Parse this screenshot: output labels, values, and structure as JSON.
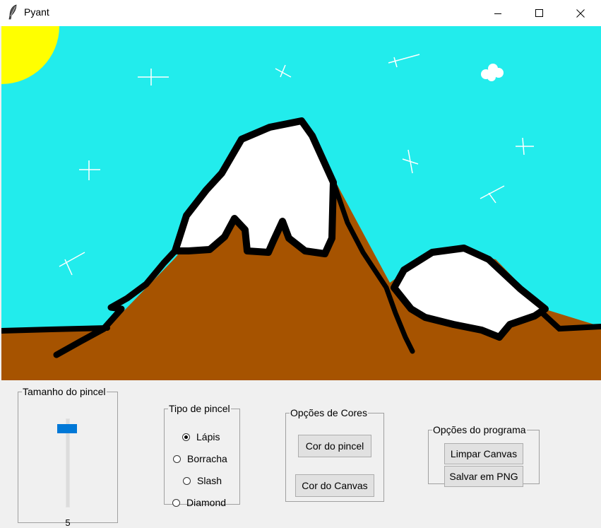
{
  "window": {
    "title": "Pyant"
  },
  "brush_size": {
    "legend": "Tamanho do pincel",
    "value": "5",
    "max_value": 100
  },
  "brush_type": {
    "legend": "Tipo de pincel",
    "options": [
      "Lápis",
      "Borracha",
      "Slash",
      "Diamond"
    ],
    "selected": "Lápis"
  },
  "color_options": {
    "legend": "Opções de Cores",
    "brush_color_label": "Cor do pincel",
    "canvas_color_label": "Cor do Canvas"
  },
  "program_options": {
    "legend": "Opções do programa",
    "clear_label": "Limpar Canvas",
    "save_label": "Salvar em PNG"
  },
  "canvas": {
    "colors": {
      "sky": "#22ecec",
      "ground": "#a65300",
      "snow": "#ffffff",
      "outline": "#000000",
      "sun": "#ffff00"
    }
  },
  "icons": {
    "app": "feather-icon",
    "minimize": "minimize-icon",
    "maximize": "maximize-icon",
    "close": "close-icon"
  }
}
